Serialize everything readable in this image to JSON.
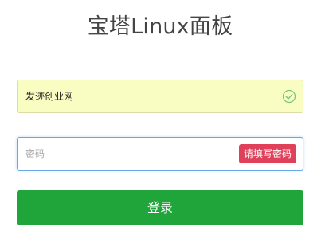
{
  "page": {
    "title": "宝塔Linux面板"
  },
  "username_field": {
    "value": "发迹创业网",
    "status_icon": "check-circle-icon"
  },
  "password_field": {
    "value": "",
    "placeholder": "密码",
    "validation_hint": "请填写密码"
  },
  "login_button": {
    "label": "登录"
  },
  "colors": {
    "accent_green": "#20a53a",
    "error_red": "#e0405a",
    "autofill_yellow": "#fafdc2",
    "focus_blue": "#68a8e8"
  }
}
